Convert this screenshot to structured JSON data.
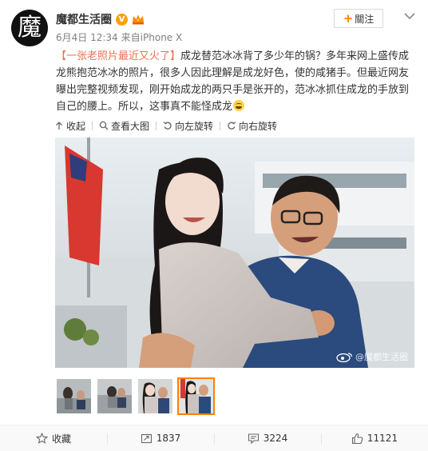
{
  "user": {
    "avatar_char": "魔",
    "name": "魔都生活圈",
    "verified_badge": "V",
    "timestamp": "6月4日 12:34",
    "source": "来自iPhone X"
  },
  "follow_button": {
    "plus": "+",
    "label": "關注"
  },
  "post": {
    "topic": "【一张老照片最近又火了】",
    "body": "成龙替范冰冰背了多少年的锅？多年来网上盛传成龙熊抱范冰冰的照片，很多人因此理解是成龙好色，使的咸猪手。但最近网友曝出完整视频发现，刚开始成龙的两只手是张开的，范冰冰抓住成龙的手放到自己的腰上。所以，这事真不能怪成龙"
  },
  "media_toolbar": {
    "collapse": "收起",
    "view_large": "查看大图",
    "rotate_left": "向左旋转",
    "rotate_right": "向右旋转"
  },
  "photo": {
    "watermark": "@魔都生活圈"
  },
  "thumbnails": {
    "count": 4,
    "active_index": 3
  },
  "footer": {
    "favorite": "收藏",
    "repost_count": "1837",
    "comment_count": "3224",
    "like_count": "11121"
  },
  "colors": {
    "accent_orange": "#ff8200",
    "topic_color": "#eb7350",
    "meta_gray": "#808080",
    "footer_bg": "#f9f9f9"
  },
  "icons": [
    "v-verified-icon",
    "crown-icon",
    "chevron-down-icon",
    "collapse-icon",
    "zoom-icon",
    "rotate-left-icon",
    "rotate-right-icon",
    "star-icon",
    "repost-icon",
    "comment-icon",
    "like-icon"
  ]
}
